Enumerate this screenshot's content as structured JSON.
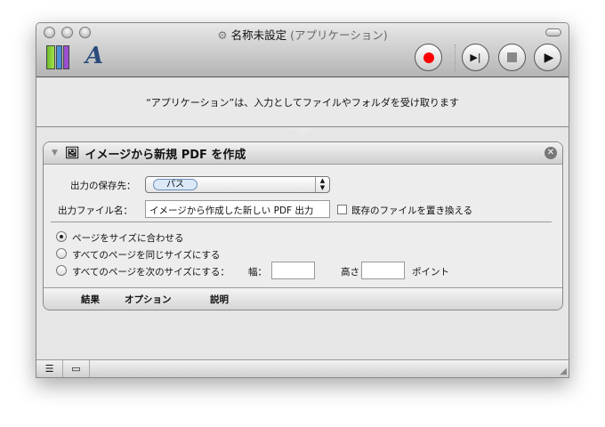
{
  "window": {
    "title": "名称未設定",
    "title_suffix": "(アプリケーション)"
  },
  "toolbar": {
    "library_icon": "library-icon",
    "media_icon": "fonts-icon",
    "record_color": "#ff0000"
  },
  "description": "“アプリケーション”は、入力としてファイルやフォルダを受け取ります",
  "action": {
    "title": "イメージから新規 PDF を作成",
    "save_to_label": "出力の保存先：",
    "save_to_value": "パス",
    "filename_label": "出力ファイル名：",
    "filename_value": "イメージから作成した新しい PDF 出力",
    "replace_label": "既存のファイルを置き換える",
    "replace_checked": false,
    "radios": [
      {
        "label": "ページをサイズに合わせる",
        "selected": true
      },
      {
        "label": "すべてのページを同じサイズにする",
        "selected": false
      },
      {
        "label": "すべてのページを次のサイズにする：",
        "selected": false
      }
    ],
    "width_label": "幅：",
    "width_value": "",
    "height_label": "高さ：",
    "height_value": "",
    "units": "ポイント",
    "footer_tabs": [
      "結果",
      "オプション",
      "説明"
    ]
  }
}
